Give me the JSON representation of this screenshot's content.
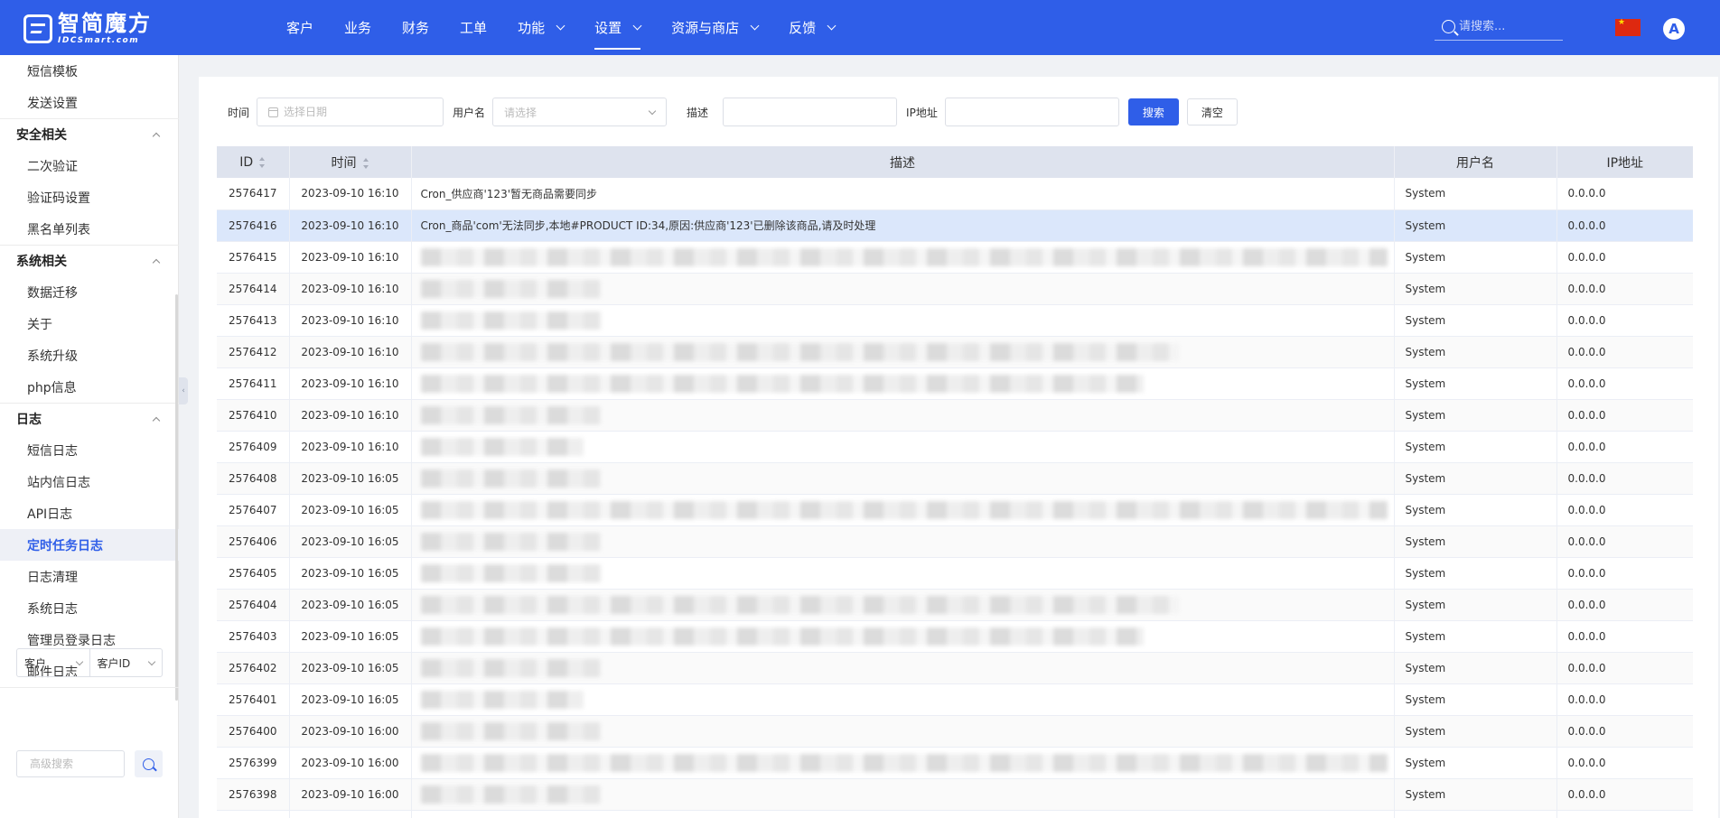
{
  "brand": {
    "name_cn": "智简魔方",
    "name_en": "IDCSmart.com"
  },
  "nav": {
    "items": [
      {
        "label": "客户",
        "dropdown": false,
        "active": false
      },
      {
        "label": "业务",
        "dropdown": false,
        "active": false
      },
      {
        "label": "财务",
        "dropdown": false,
        "active": false
      },
      {
        "label": "工单",
        "dropdown": false,
        "active": false
      },
      {
        "label": "功能",
        "dropdown": true,
        "active": false
      },
      {
        "label": "设置",
        "dropdown": true,
        "active": true
      },
      {
        "label": "资源与商店",
        "dropdown": true,
        "active": false
      },
      {
        "label": "反馈",
        "dropdown": true,
        "active": false
      }
    ],
    "search_placeholder": "请搜索...",
    "avatar_letter": "A",
    "accent_color": "#2f5ee8"
  },
  "sidebar": {
    "pre_items": [
      "短信模板",
      "发送设置"
    ],
    "groups": [
      {
        "title": "安全相关",
        "items": [
          "二次验证",
          "验证码设置",
          "黑名单列表"
        ]
      },
      {
        "title": "系统相关",
        "items": [
          "数据迁移",
          "关于",
          "系统升级",
          "php信息"
        ]
      },
      {
        "title": "日志",
        "items": [
          "短信日志",
          "站内信日志",
          "API日志",
          "定时任务日志",
          "日志清理",
          "系统日志",
          "管理员登录日志",
          "邮件日志"
        ]
      }
    ],
    "active_item": "定时任务日志",
    "bottom": {
      "type_select": "客户",
      "field_select": "客户ID",
      "adv_search_placeholder": "高级搜索"
    }
  },
  "filters": {
    "time_label": "时间",
    "date_placeholder": "选择日期",
    "user_label": "用户名",
    "user_placeholder": "请选择",
    "desc_label": "描述",
    "ip_label": "IP地址",
    "search_button": "搜索",
    "clear_button": "清空"
  },
  "table": {
    "columns": [
      "ID",
      "时间",
      "描述",
      "用户名",
      "IP地址"
    ],
    "rows": [
      {
        "id": "2576417",
        "time": "2023-09-10 16:10",
        "desc": "Cron_供应商'123'暂无商品需要同步",
        "user": "System",
        "ip": "0.0.0.0"
      },
      {
        "id": "2576416",
        "time": "2023-09-10 16:10",
        "desc": "Cron_商品'com'无法同步,本地#PRODUCT ID:34,原因:供应商'123'已删除该商品,请及时处理",
        "user": "System",
        "ip": "0.0.0.0",
        "selected": true
      },
      {
        "id": "2576415",
        "time": "2023-09-10 16:10",
        "desc": "",
        "blur": 1070,
        "user": "System",
        "ip": "0.0.0.0"
      },
      {
        "id": "2576414",
        "time": "2023-09-10 16:10",
        "desc": "",
        "blur": 200,
        "user": "System",
        "ip": "0.0.0.0"
      },
      {
        "id": "2576413",
        "time": "2023-09-10 16:10",
        "desc": "",
        "blur": 200,
        "user": "System",
        "ip": "0.0.0.0"
      },
      {
        "id": "2576412",
        "time": "2023-09-10 16:10",
        "desc": "",
        "blur": 840,
        "user": "System",
        "ip": "0.0.0.0"
      },
      {
        "id": "2576411",
        "time": "2023-09-10 16:10",
        "desc": "",
        "blur": 800,
        "user": "System",
        "ip": "0.0.0.0"
      },
      {
        "id": "2576410",
        "time": "2023-09-10 16:10",
        "desc": "",
        "blur": 200,
        "user": "System",
        "ip": "0.0.0.0"
      },
      {
        "id": "2576409",
        "time": "2023-09-10 16:10",
        "desc": "",
        "blur": 180,
        "user": "System",
        "ip": "0.0.0.0"
      },
      {
        "id": "2576408",
        "time": "2023-09-10 16:05",
        "desc": "",
        "blur": 200,
        "user": "System",
        "ip": "0.0.0.0"
      },
      {
        "id": "2576407",
        "time": "2023-09-10 16:05",
        "desc": "",
        "blur": 1070,
        "user": "System",
        "ip": "0.0.0.0"
      },
      {
        "id": "2576406",
        "time": "2023-09-10 16:05",
        "desc": "",
        "blur": 200,
        "user": "System",
        "ip": "0.0.0.0"
      },
      {
        "id": "2576405",
        "time": "2023-09-10 16:05",
        "desc": "",
        "blur": 200,
        "user": "System",
        "ip": "0.0.0.0"
      },
      {
        "id": "2576404",
        "time": "2023-09-10 16:05",
        "desc": "",
        "blur": 840,
        "user": "System",
        "ip": "0.0.0.0"
      },
      {
        "id": "2576403",
        "time": "2023-09-10 16:05",
        "desc": "",
        "blur": 800,
        "user": "System",
        "ip": "0.0.0.0"
      },
      {
        "id": "2576402",
        "time": "2023-09-10 16:05",
        "desc": "",
        "blur": 200,
        "user": "System",
        "ip": "0.0.0.0"
      },
      {
        "id": "2576401",
        "time": "2023-09-10 16:05",
        "desc": "",
        "blur": 180,
        "user": "System",
        "ip": "0.0.0.0"
      },
      {
        "id": "2576400",
        "time": "2023-09-10 16:00",
        "desc": "",
        "blur": 200,
        "user": "System",
        "ip": "0.0.0.0"
      },
      {
        "id": "2576399",
        "time": "2023-09-10 16:00",
        "desc": "",
        "blur": 1070,
        "user": "System",
        "ip": "0.0.0.0"
      },
      {
        "id": "2576398",
        "time": "2023-09-10 16:00",
        "desc": "",
        "blur": 200,
        "user": "System",
        "ip": "0.0.0.0"
      },
      {
        "id": "",
        "time": "",
        "desc": "",
        "blur": 0,
        "user": "",
        "ip": ""
      }
    ]
  }
}
